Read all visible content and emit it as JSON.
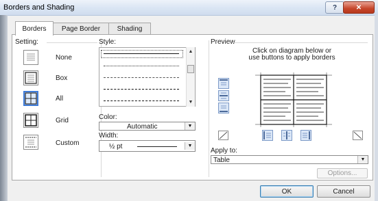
{
  "window": {
    "title": "Borders and Shading",
    "help_label": "?",
    "close_label": "✕"
  },
  "tabs": [
    {
      "label": "Borders",
      "active": true
    },
    {
      "label": "Page Border",
      "active": false
    },
    {
      "label": "Shading",
      "active": false
    }
  ],
  "setting": {
    "label": "Setting:",
    "options": [
      {
        "label": "None",
        "icon": "setting-none-icon",
        "selected": false
      },
      {
        "label": "Box",
        "icon": "setting-box-icon",
        "selected": false
      },
      {
        "label": "All",
        "icon": "setting-all-icon",
        "selected": true
      },
      {
        "label": "Grid",
        "icon": "setting-grid-icon",
        "selected": false
      },
      {
        "label": "Custom",
        "icon": "setting-custom-icon",
        "selected": false
      }
    ]
  },
  "style": {
    "label": "Style:",
    "options": [
      "solid",
      "dotted",
      "dashed-short",
      "dashed",
      "dash-dot"
    ],
    "selected_index": 0
  },
  "color": {
    "label": "Color:",
    "value": "Automatic"
  },
  "width": {
    "label": "Width:",
    "value": "½ pt"
  },
  "preview": {
    "label": "Preview",
    "instructions_line1": "Click on diagram below or",
    "instructions_line2": "use buttons to apply borders"
  },
  "apply_to": {
    "label": "Apply to:",
    "value": "Table"
  },
  "buttons": {
    "options": "Options...",
    "ok": "OK",
    "cancel": "Cancel"
  },
  "colors": {
    "accent": "#3d7bd9",
    "close": "#c6452a",
    "panel": "#ffffff",
    "background": "#f0f0f0"
  }
}
